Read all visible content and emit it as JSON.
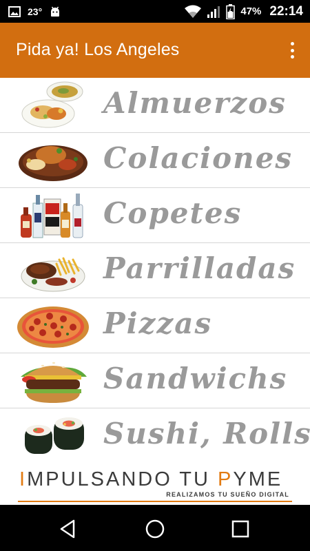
{
  "status_bar": {
    "temperature": "23°",
    "battery": "47%",
    "time": "22:14",
    "icons": [
      "image-icon",
      "android-icon",
      "wifi-icon",
      "signal-icon",
      "battery-icon"
    ]
  },
  "app_bar": {
    "title": "Pida ya! Los Angeles",
    "menu_icon": "overflow-menu-icon",
    "color": "#d26e10"
  },
  "menu": {
    "items": [
      {
        "label": "Almuerzos",
        "image": "lunch-plate-image"
      },
      {
        "label": "Colaciones",
        "image": "snack-plate-image"
      },
      {
        "label": "Copetes",
        "image": "drinks-bottles-image"
      },
      {
        "label": "Parrilladas",
        "image": "grill-platter-image"
      },
      {
        "label": "Pizzas",
        "image": "pizza-image"
      },
      {
        "label": "Sandwichs",
        "image": "burger-image"
      },
      {
        "label": "Sushi, Rolls",
        "image": "sushi-image"
      }
    ]
  },
  "banner": {
    "title_I": "I",
    "title_mid": "MPULSANDO TU ",
    "title_P": "P",
    "title_end": "YME",
    "subtitle": "REALIZAMOS TU SUEÑO DIGITAL",
    "accent_color": "#e27b12"
  },
  "nav_bar": {
    "buttons": [
      "back-icon",
      "home-icon",
      "recents-icon"
    ]
  }
}
